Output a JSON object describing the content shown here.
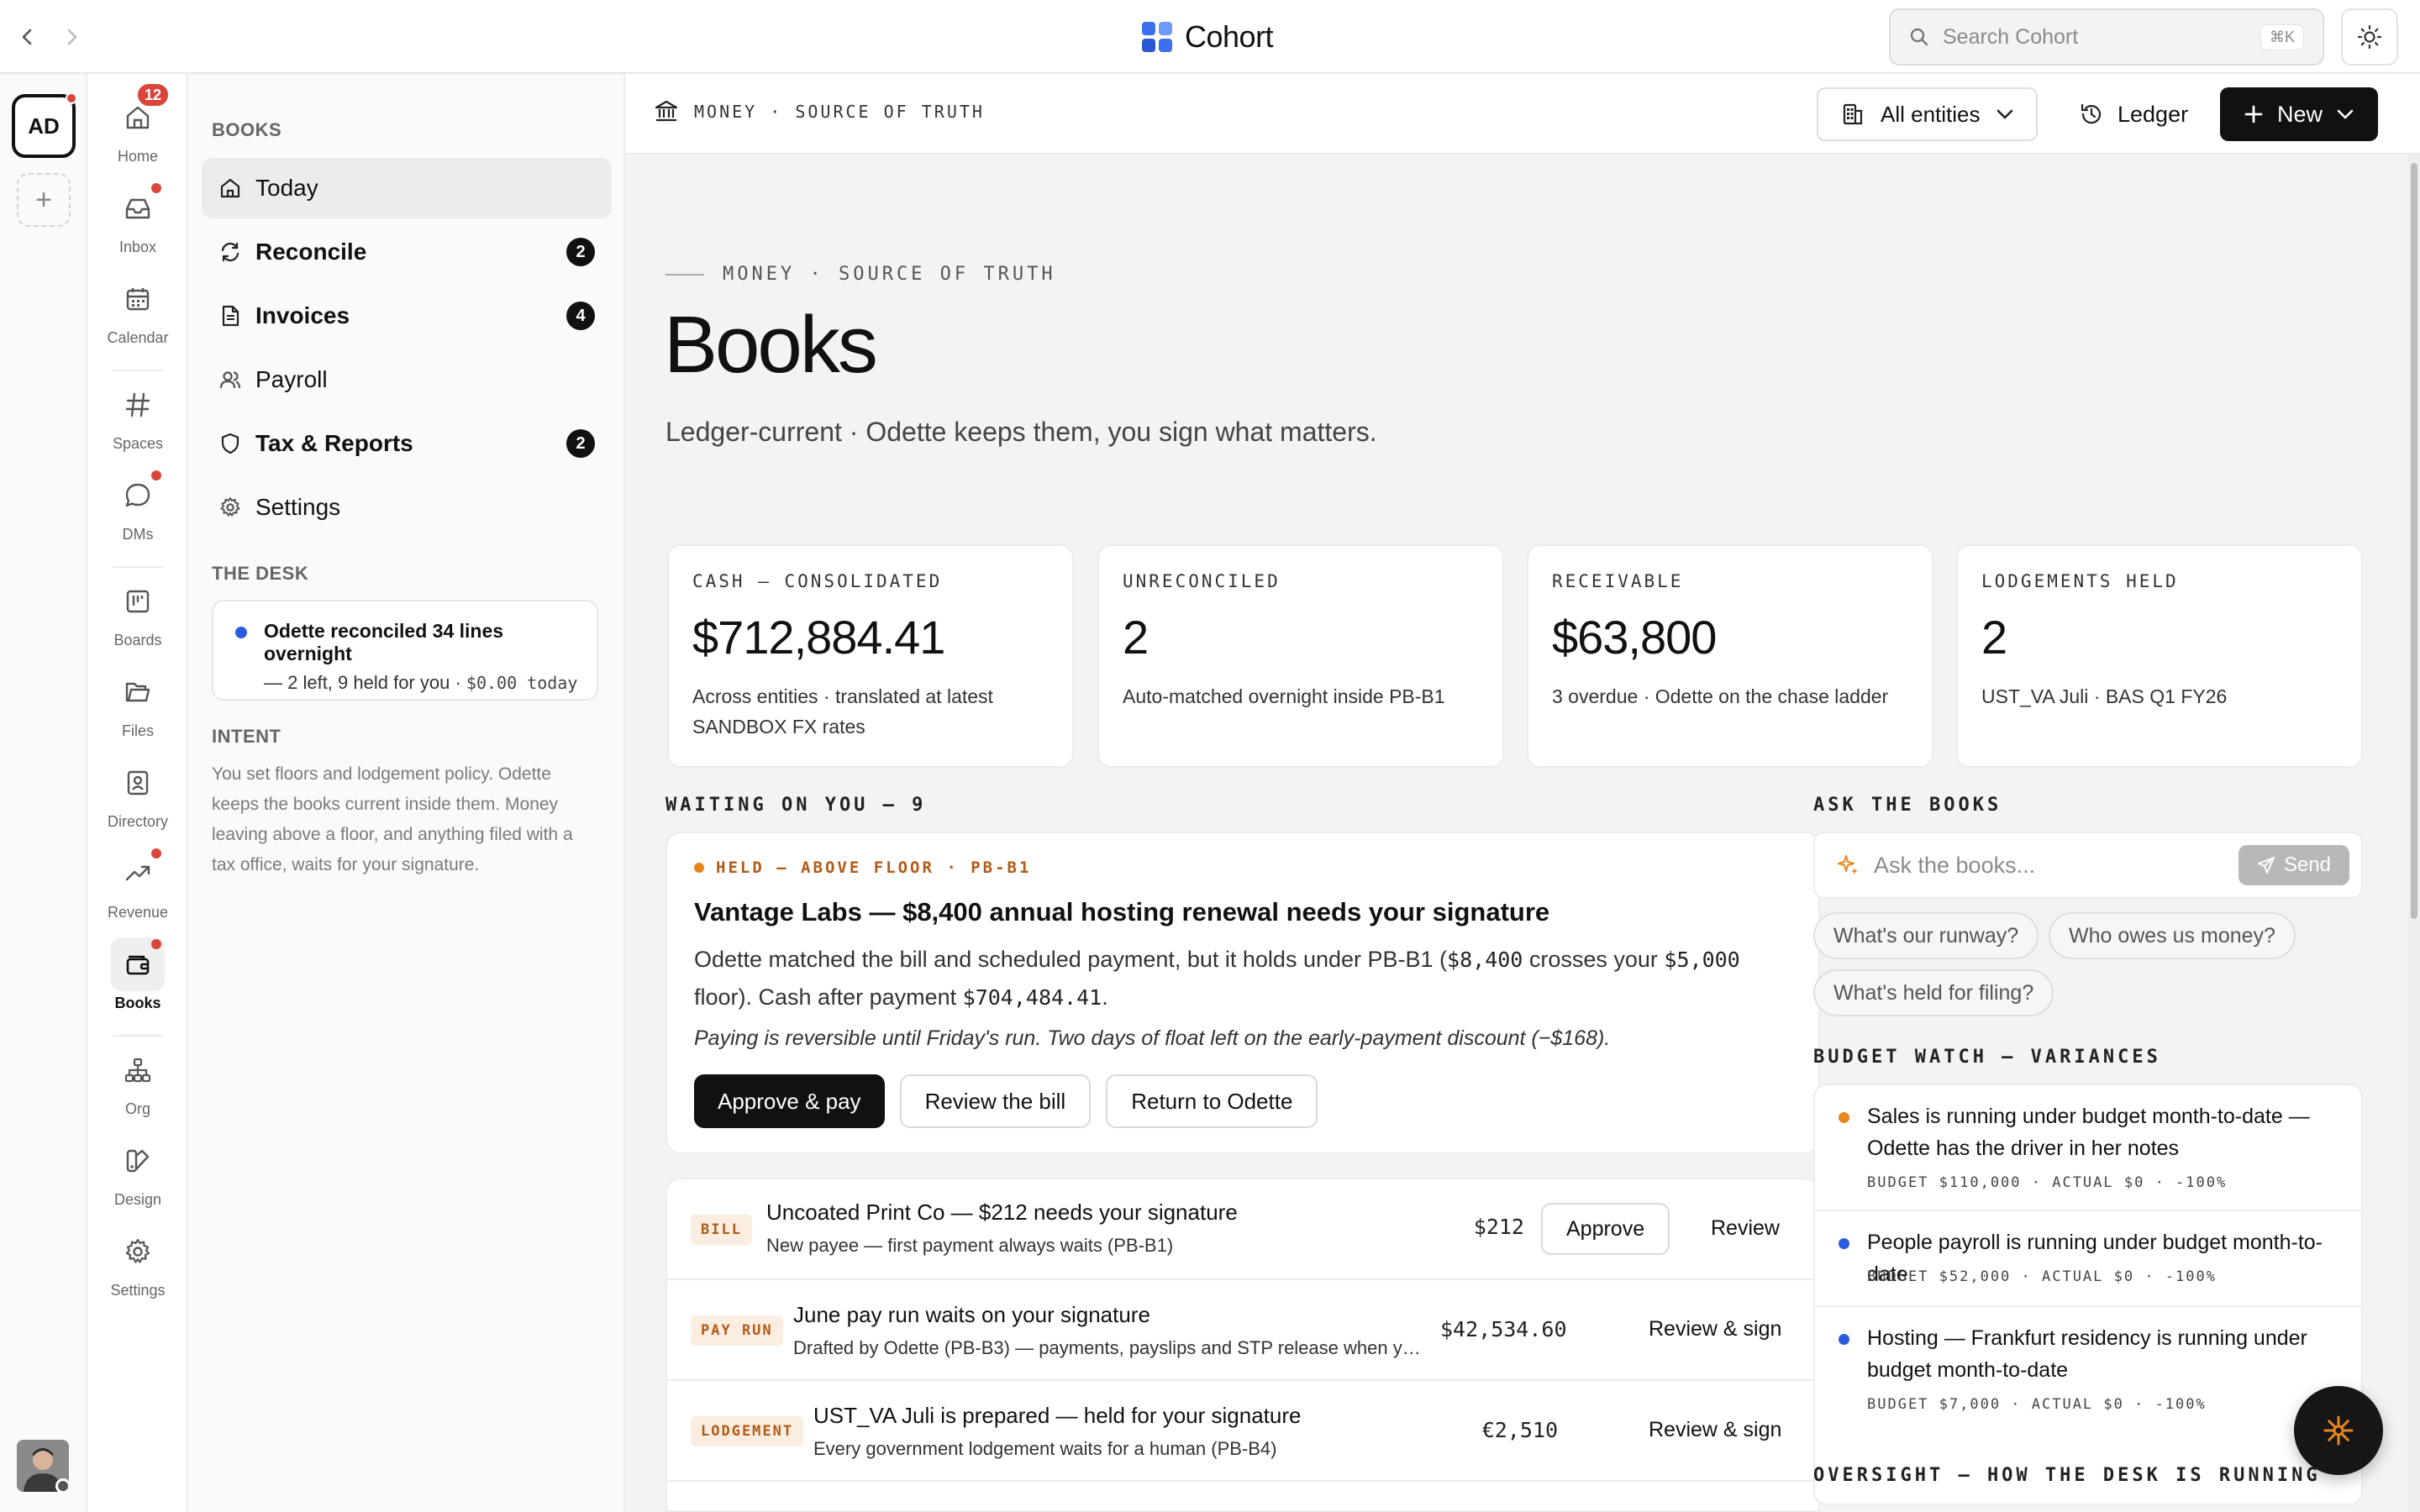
{
  "topbar": {
    "brand": "Cohort",
    "search_placeholder": "Search Cohort",
    "search_shortcut": "⌘K"
  },
  "workspace": {
    "initials": "AD",
    "add_label": "+"
  },
  "rail": {
    "home": "Home",
    "home_badge": "12",
    "inbox": "Inbox",
    "calendar": "Calendar",
    "spaces": "Spaces",
    "dms": "DMs",
    "boards": "Boards",
    "files": "Files",
    "directory": "Directory",
    "revenue": "Revenue",
    "books": "Books",
    "org": "Org",
    "design": "Design",
    "settings": "Settings"
  },
  "sidebar": {
    "heading": "BOOKS",
    "items": [
      {
        "label": "Today"
      },
      {
        "label": "Reconcile",
        "badge": "2"
      },
      {
        "label": "Invoices",
        "badge": "4"
      },
      {
        "label": "Payroll"
      },
      {
        "label": "Tax & Reports",
        "badge": "2"
      },
      {
        "label": "Settings"
      }
    ],
    "desk_heading": "THE DESK",
    "desk_title": "Odette reconciled 34 lines overnight",
    "desk_sub": "— 2 left, 9 held for you · ",
    "desk_sub_mono": "$0.00 today",
    "intent_heading": "INTENT",
    "intent_text": "You set floors and lodgement policy. Odette keeps the books current inside them. Money leaving above a floor, and anything filed with a tax office, waits for your signature."
  },
  "header": {
    "crumb": "MONEY · SOURCE OF TRUTH",
    "entities": "All entities",
    "ledger": "Ledger",
    "new": "New"
  },
  "page": {
    "eyebrow": "MONEY · SOURCE OF TRUTH",
    "title": "Books",
    "subtitle": "Ledger-current · Odette keeps them, you sign what matters."
  },
  "kpis": [
    {
      "label": "CASH — CONSOLIDATED",
      "value": "$712,884.41",
      "note": "Across entities · translated at latest SANDBOX FX rates"
    },
    {
      "label": "UNRECONCILED",
      "value": "2",
      "note": "Auto-matched overnight inside PB-B1"
    },
    {
      "label": "RECEIVABLE",
      "value": "$63,800",
      "note": "3 overdue · Odette on the chase ladder"
    },
    {
      "label": "LODGEMENTS HELD",
      "value": "2",
      "note": "UST_VA Juli · BAS Q1 FY26"
    }
  ],
  "waiting": {
    "heading": "WAITING ON YOU — 9",
    "held": {
      "tag": "HELD — ABOVE FLOOR · PB-B1",
      "title": "Vantage Labs — $8,400 annual hosting renewal needs your signature",
      "body_1": "Odette matched the bill and scheduled payment, but it holds under PB-B1 (",
      "body_amt1": "$8,400",
      "body_2": " crosses your ",
      "body_amt2": "$5,000",
      "body_3": " floor). Cash after payment ",
      "body_amt3": "$704,484.41",
      "body_4": ".",
      "note": "Paying is reversible until Friday's run. Two days of float left on the early-payment discount (−$168).",
      "approve": "Approve & pay",
      "review": "Review the bill",
      "return": "Return to Odette"
    },
    "rows": [
      {
        "tag": "BILL",
        "title": "Uncoated Print Co — $212 needs your signature",
        "sub": "New payee — first payment always waits (PB-B1)",
        "amount": "$212",
        "action": "Approve",
        "link": "Review"
      },
      {
        "tag": "PAY RUN",
        "title": "June pay run waits on your signature",
        "sub": "Drafted by Odette (PB-B3) — payments, payslips and STP release when you sign",
        "amount": "$42,534.60",
        "link": "Review & sign"
      },
      {
        "tag": "LODGEMENT",
        "title": "UST_VA Juli is prepared — held for your signature",
        "sub": "Every government lodgement waits for a human (PB-B4)",
        "amount": "€2,510",
        "link": "Review & sign"
      }
    ]
  },
  "ask": {
    "heading": "ASK THE BOOKS",
    "placeholder": "Ask the books...",
    "send": "Send",
    "chips": [
      "What's our runway?",
      "Who owes us money?",
      "What's held for filing?"
    ]
  },
  "budget": {
    "heading": "BUDGET WATCH — VARIANCES",
    "rows": [
      {
        "text": "Sales is running under budget month-to-date — Odette has the driver in her notes",
        "meta": "BUDGET $110,000 · ACTUAL $0 · -100%",
        "color": "#e8851c"
      },
      {
        "text": "People payroll is running under budget month-to-date",
        "meta": "BUDGET $52,000 · ACTUAL $0 · -100%",
        "color": "#2b5ce0"
      },
      {
        "text": "Hosting — Frankfurt residency is running under budget month-to-date",
        "meta": "BUDGET $7,000 · ACTUAL $0 · -100%",
        "color": "#2b5ce0"
      }
    ]
  },
  "oversight": {
    "heading": "OVERSIGHT — HOW THE DESK IS RUNNING"
  },
  "colors": {
    "accent_orange": "#e8851c",
    "accent_blue": "#2b5ce0",
    "badge_red": "#d9453a",
    "dark": "#111111"
  }
}
